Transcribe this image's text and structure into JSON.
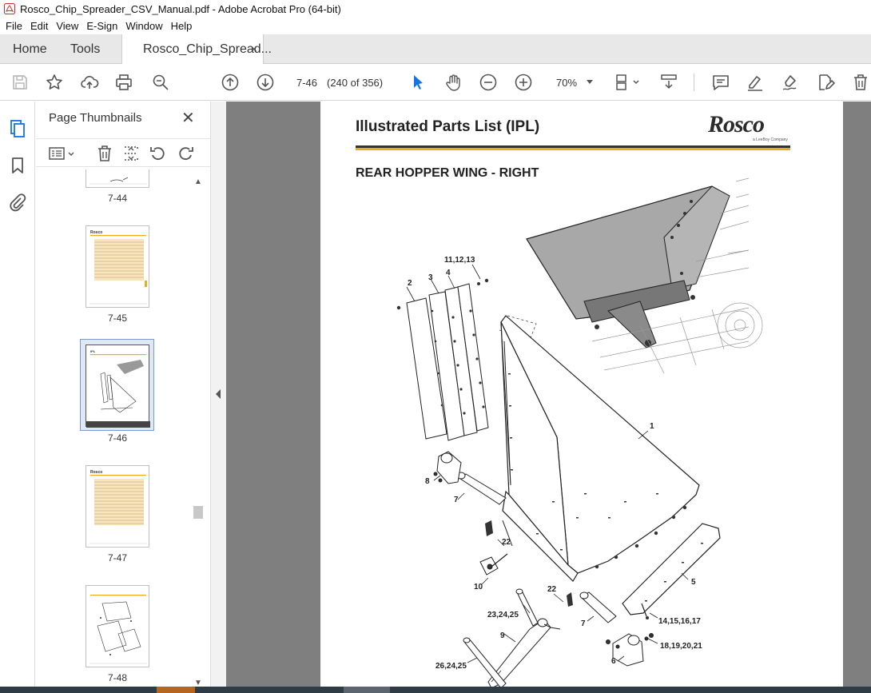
{
  "window": {
    "title": "Rosco_Chip_Spreader_CSV_Manual.pdf - Adobe Acrobat Pro (64-bit)"
  },
  "menu": [
    "File",
    "Edit",
    "View",
    "E-Sign",
    "Window",
    "Help"
  ],
  "tabs": {
    "home": "Home",
    "tools": "Tools",
    "document": "Rosco_Chip_Spread...",
    "close": "×"
  },
  "toolbar": {
    "page_value": "7-46",
    "page_count": "(240 of 356)",
    "zoom": "70%"
  },
  "thumbnails": {
    "title": "Page Thumbnails",
    "close": "✕",
    "pages": [
      {
        "label": "7-44"
      },
      {
        "label": "7-45"
      },
      {
        "label": "7-46",
        "selected": true
      },
      {
        "label": "7-47"
      },
      {
        "label": "7-48"
      }
    ]
  },
  "document": {
    "header_title": "Illustrated Parts List (IPL)",
    "brand": "Rosco",
    "brand_sub": "a LeeBoy Company",
    "section_title": "REAR HOPPER WING - RIGHT",
    "callouts": [
      "11,12,13",
      "2",
      "3",
      "4",
      "1",
      "8",
      "7",
      "22",
      "10",
      "5",
      "22",
      "23,24,25",
      "7",
      "14,15,16,17",
      "9",
      "18,19,20,21",
      "6",
      "26,24,25"
    ]
  },
  "colors": {
    "accent_blue": "#1473e6",
    "rule_orange": "#f0a81c",
    "viewport_gray": "#7f7f7f"
  }
}
